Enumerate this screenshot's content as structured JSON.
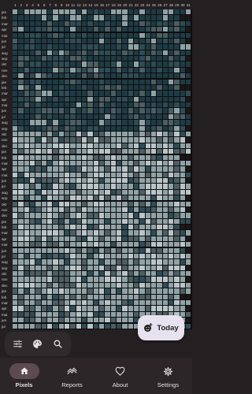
{
  "header": {
    "days": [
      "1",
      "2",
      "3",
      "4",
      "5",
      "6",
      "7",
      "8",
      "9",
      "10",
      "11",
      "12",
      "13",
      "14",
      "15",
      "16",
      "17",
      "18",
      "19",
      "20",
      "21",
      "22",
      "23",
      "24",
      "25",
      "26",
      "27",
      "28",
      "29",
      "30",
      "31"
    ]
  },
  "months": [
    "jan",
    "feb",
    "mar",
    "apr",
    "mai",
    "jun",
    "jul",
    "aug",
    "sep",
    "okt",
    "nov",
    "dec",
    "jan",
    "feb",
    "mar",
    "apr",
    "mai",
    "jun",
    "jul",
    "aug",
    "sep",
    "okt",
    "nov",
    "dec",
    "jan",
    "feb",
    "mar",
    "apr",
    "mai",
    "jun",
    "jul",
    "aug",
    "sep",
    "okt",
    "nov",
    "dec",
    "jan",
    "feb",
    "mar",
    "apr",
    "mai",
    "jun",
    "jul",
    "aug",
    "sep",
    "okt",
    "nov",
    "dec",
    "jan",
    "feb",
    "mar",
    "apr",
    "mai",
    "jun",
    "jul"
  ],
  "grid": {
    "rows": 55,
    "cols": 31,
    "colors": {
      "dark_teal": "#1e3b44",
      "mid_teal": "#2f4c55",
      "light_gray": "#8fa2a6",
      "lighter_gray": "#b9c5c8",
      "dark_gray": "#4d5e63",
      "empty": "#1b1718",
      "gridline": "#0e0c0d"
    }
  },
  "toolbar": {
    "buttons": [
      {
        "icon": "filter-sliders-icon"
      },
      {
        "icon": "palette-icon"
      },
      {
        "icon": "search-icon"
      }
    ]
  },
  "fab": {
    "label": "Today",
    "icon": "add-reaction-icon"
  },
  "nav": {
    "items": [
      {
        "label": "Pixels",
        "icon": "home-icon",
        "active": true
      },
      {
        "label": "Reports",
        "icon": "trend-icon",
        "active": false
      },
      {
        "label": "About",
        "icon": "heart-icon",
        "active": false
      },
      {
        "label": "Settings",
        "icon": "gear-icon",
        "active": false
      }
    ]
  },
  "theme": {
    "background": "#241f21",
    "nav_background": "#2c2628",
    "active_pill": "#5d4b51",
    "fab_background": "#e7e2ef"
  }
}
